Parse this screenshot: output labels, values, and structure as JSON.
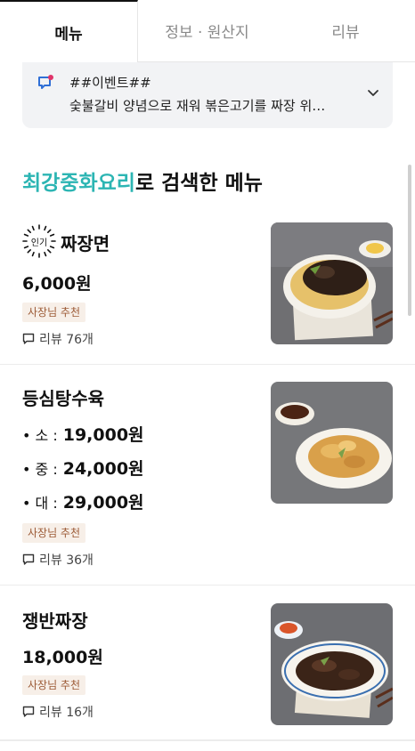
{
  "tabs": [
    {
      "label": "메뉴",
      "active": true
    },
    {
      "label": "정보 · 원산지",
      "active": false
    },
    {
      "label": "리뷰",
      "active": false
    }
  ],
  "notice": {
    "title": "##이벤트##",
    "body": "숯불갈비 양념으로 재워 볶은고기를  짜장 위…",
    "icon": "megaphone-icon"
  },
  "heading": {
    "keyword": "최강중화요리",
    "suffix": "로 검색한 메뉴"
  },
  "menu": [
    {
      "popular_label": "인기",
      "name": "짜장면",
      "price": "6,000원",
      "badge": "사장님 추천",
      "review": "리뷰 76개"
    },
    {
      "name": "등심탕수육",
      "sizes": [
        {
          "label": "• 소 :",
          "price": "19,000원"
        },
        {
          "label": "• 중 :",
          "price": "24,000원"
        },
        {
          "label": "• 대 :",
          "price": "29,000원"
        }
      ],
      "badge": "사장님 추천",
      "review": "리뷰 36개"
    },
    {
      "name": "쟁반짜장",
      "price": "18,000원",
      "badge": "사장님 추천",
      "review": "리뷰 16개"
    }
  ],
  "colors": {
    "accent": "#2cb5b3",
    "badge_bg": "#f7efe8",
    "badge_text": "#9c5a35",
    "notice_bg": "#f2f3f5"
  }
}
